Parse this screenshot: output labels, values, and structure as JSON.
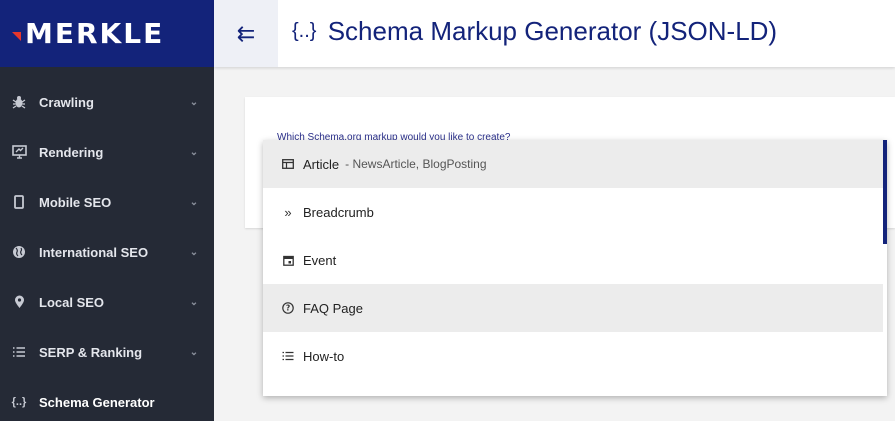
{
  "brand": {
    "logo_text": "MERKLE",
    "primary_color": "#13237a",
    "accent_color": "#e6362c"
  },
  "header": {
    "title": "Schema Markup Generator (JSON-LD)",
    "title_icon": "{..}",
    "collapse_icon": "⇇"
  },
  "sidebar": {
    "items": [
      {
        "label": "Crawling",
        "icon": "bug-icon",
        "expandable": true
      },
      {
        "label": "Rendering",
        "icon": "monitor-icon",
        "expandable": true
      },
      {
        "label": "Mobile SEO",
        "icon": "phone-icon",
        "expandable": true
      },
      {
        "label": "International SEO",
        "icon": "globe-icon",
        "expandable": true
      },
      {
        "label": "Local SEO",
        "icon": "pin-icon",
        "expandable": true
      },
      {
        "label": "SERP & Ranking",
        "icon": "list-icon",
        "expandable": true
      },
      {
        "label": "Schema Generator",
        "icon": "braces-icon",
        "expandable": false
      }
    ]
  },
  "form": {
    "question": "Which Schema.org markup would you like to create?"
  },
  "dropdown": {
    "options": [
      {
        "label": "Article",
        "sublabel": "- NewsArticle, BlogPosting",
        "icon": "article-icon",
        "highlighted": true
      },
      {
        "label": "Breadcrumb",
        "sublabel": "",
        "icon": "double-chevron-icon",
        "highlighted": false
      },
      {
        "label": "Event",
        "sublabel": "",
        "icon": "calendar-icon",
        "highlighted": false
      },
      {
        "label": "FAQ Page",
        "sublabel": "",
        "icon": "question-circle-icon",
        "highlighted": true
      },
      {
        "label": "How-to",
        "sublabel": "",
        "icon": "list-icon",
        "highlighted": false
      }
    ]
  }
}
